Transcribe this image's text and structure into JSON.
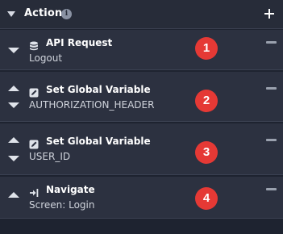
{
  "header": {
    "title": "Action",
    "info_icon": "info-icon",
    "add_icon": "plus-icon"
  },
  "actions": [
    {
      "icon": "database-icon",
      "title": "API Request",
      "subtitle": "Logout",
      "badge": "1"
    },
    {
      "icon": "edit-icon",
      "title": "Set Global Variable",
      "subtitle": "AUTHORIZATION_HEADER",
      "badge": "2"
    },
    {
      "icon": "edit-icon",
      "title": "Set Global Variable",
      "subtitle": "USER_ID",
      "badge": "3"
    },
    {
      "icon": "navigate-arrow-icon",
      "title": "Navigate",
      "subtitle": "Screen: Login",
      "badge": "4"
    }
  ],
  "colors": {
    "badge": "#e53935",
    "panel_bg": "#1e2330",
    "card_bg": "#2c3140"
  }
}
